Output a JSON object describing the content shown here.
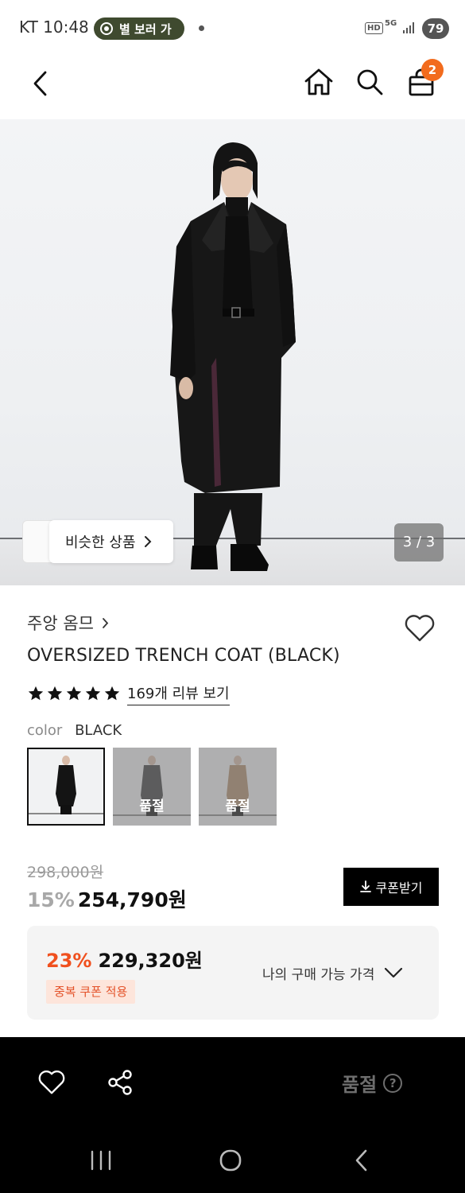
{
  "status_bar": {
    "time": "KT 10:48",
    "pill_label": "별 보러 가",
    "network_hd": "HD",
    "network_5g": "5G",
    "battery": "79"
  },
  "header": {
    "back_icon": "chevron-left-icon",
    "home_icon": "home-icon",
    "search_icon": "search-icon",
    "cart_icon": "shopping-bag-icon",
    "cart_badge": "2",
    "badge_color": "#f26b1d"
  },
  "gallery": {
    "similar_label": "비슷한 상품",
    "counter": "3 / 3"
  },
  "product": {
    "brand": "주앙 옴므",
    "name": "OVERSIZED TRENCH COAT (BLACK)",
    "rating_stars": 5,
    "review_link": "169개 리뷰 보기",
    "color_label": "color",
    "color_value": "BLACK",
    "swatches": [
      {
        "color": "black",
        "status": ""
      },
      {
        "color": "charcoal",
        "status": "품절"
      },
      {
        "color": "beige",
        "status": "품절"
      }
    ]
  },
  "price": {
    "original": "298,000원",
    "discount": "15%",
    "sale": "254,790원",
    "coupon_button": "쿠폰받기",
    "benefit_discount": "23%",
    "benefit_price": "229,320원",
    "benefit_tag": "중복 쿠폰 적용",
    "my_price_label": "나의 구매 가능 가격",
    "accent_color": "#f0501e"
  },
  "bottom_bar": {
    "status": "품절",
    "help": "?"
  }
}
